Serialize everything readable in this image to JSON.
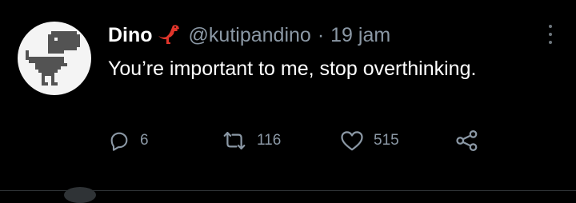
{
  "tweet": {
    "display_name": "Dino",
    "name_emoji": "red-dinosaur-emoji",
    "handle": "@kutipandino",
    "separator": "·",
    "time": "19 jam",
    "text": "You’re important to me, stop overthinking.",
    "actions": {
      "reply_count": "6",
      "retweet_count": "116",
      "like_count": "515"
    }
  },
  "icons": {
    "avatar": "pixel-dinosaur-icon",
    "more": "more-vertical-icon",
    "reply": "reply-icon",
    "retweet": "retweet-icon",
    "like": "heart-icon",
    "share": "share-icon"
  },
  "colors": {
    "background": "#000000",
    "primary_text": "#ffffff",
    "secondary_text": "#8b98a5",
    "divider": "#2f3336",
    "emoji_red": "#e0352b"
  }
}
